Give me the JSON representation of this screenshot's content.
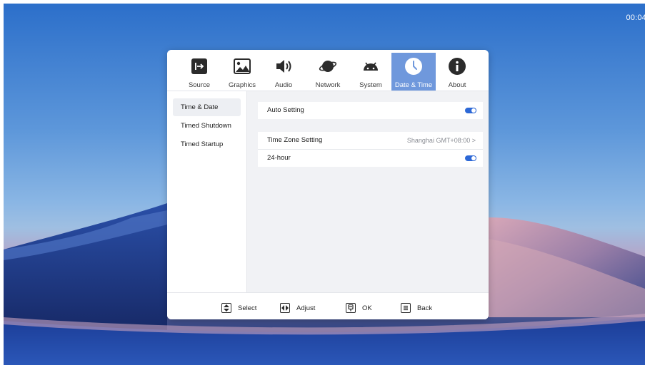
{
  "clock": "00:04",
  "tabs": [
    {
      "label": "Source",
      "icon": "source-icon"
    },
    {
      "label": "Graphics",
      "icon": "image-icon"
    },
    {
      "label": "Audio",
      "icon": "speaker-icon"
    },
    {
      "label": "Network",
      "icon": "planet-icon"
    },
    {
      "label": "System",
      "icon": "android-icon"
    },
    {
      "label": "Date & Time",
      "icon": "clock-icon",
      "active": true
    },
    {
      "label": "About",
      "icon": "info-icon"
    }
  ],
  "sidebar": {
    "items": [
      {
        "label": "Time & Date",
        "active": true
      },
      {
        "label": "Timed Shutdown"
      },
      {
        "label": "Timed Startup"
      }
    ]
  },
  "settings": {
    "auto_setting": {
      "label": "Auto Setting",
      "enabled": true
    },
    "time_zone": {
      "label": "Time Zone Setting",
      "value": "Shanghai GMT+08:00",
      "arrow": ">"
    },
    "hour24": {
      "label": "24-hour",
      "enabled": true
    }
  },
  "footer": {
    "select": "Select",
    "adjust": "Adjust",
    "ok": "OK",
    "back": "Back"
  },
  "colors": {
    "accent": "#2d68d6",
    "active_tab": "#6f98dc",
    "panel_bg": "#f1f2f5"
  }
}
